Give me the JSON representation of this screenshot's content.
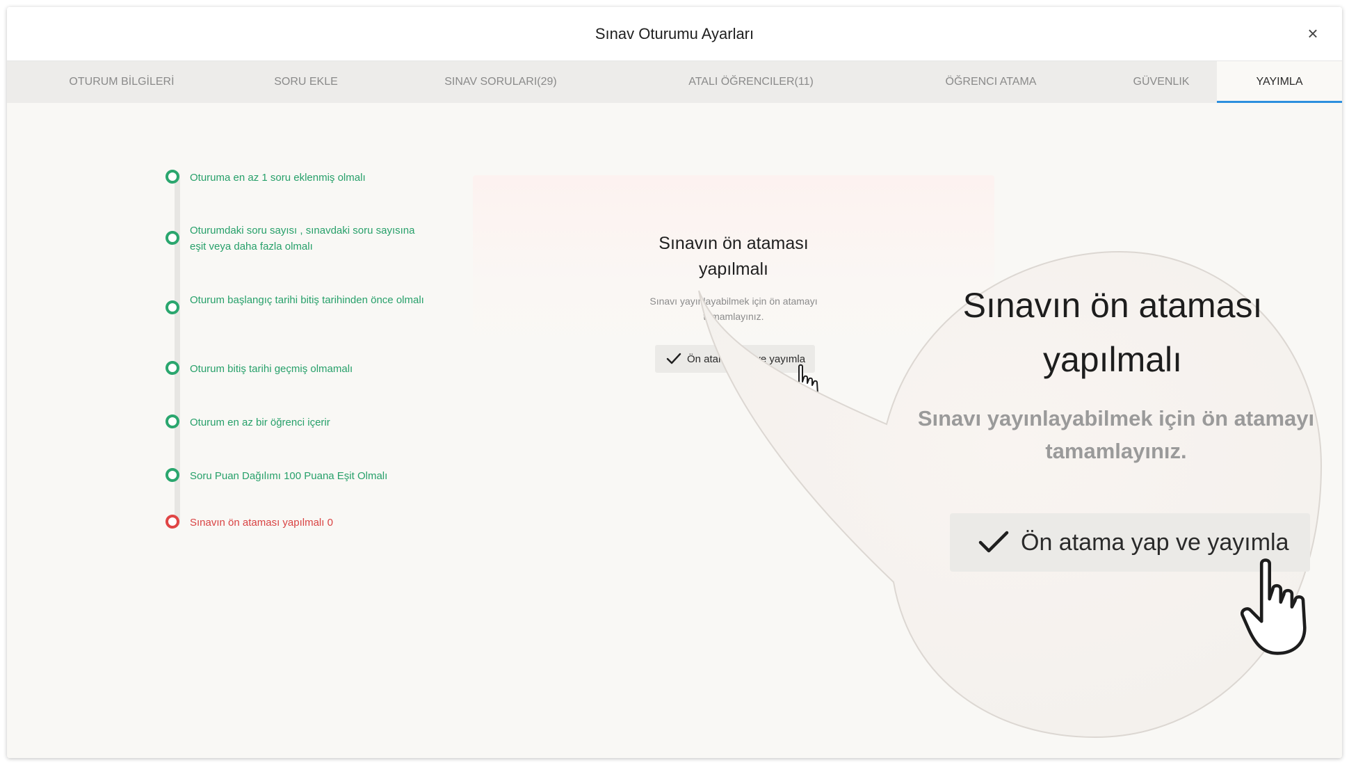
{
  "modal": {
    "title": "Sınav Oturumu Ayarları",
    "close_icon": "×"
  },
  "tabs": [
    {
      "label": "OTURUM BİLGİLERİ",
      "active": false
    },
    {
      "label": "SORU EKLE",
      "active": false
    },
    {
      "label": "SINAV SORULARI(29)",
      "active": false
    },
    {
      "label": "ATALI ÖĞRENCILER(11)",
      "active": false
    },
    {
      "label": "ÖĞRENCI ATAMA",
      "active": false
    },
    {
      "label": "GÜVENLIK",
      "active": false
    },
    {
      "label": "YAYIMLA",
      "active": true
    }
  ],
  "checklist": [
    {
      "label": "Oturuma en az 1 soru eklenmiş olmalı",
      "status": "passed"
    },
    {
      "label": "Oturumdaki soru sayısı , sınavdaki soru sayısına eşit veya daha fazla olmalı",
      "status": "passed"
    },
    {
      "label": "Oturum başlangıç tarihi bitiş tarihinden önce olmalı",
      "status": "passed"
    },
    {
      "label": "Oturum bitiş tarihi geçmiş olmamalı",
      "status": "passed"
    },
    {
      "label": "Oturum en az bir öğrenci içerir",
      "status": "passed"
    },
    {
      "label": "Soru Puan Dağılımı 100 Puana Eşit Olmalı",
      "status": "passed"
    },
    {
      "label": "Sınavın ön ataması yapılmalı 0",
      "status": "failed"
    }
  ],
  "panel": {
    "title": "Sınavın ön ataması yapılmalı",
    "description": "Sınavı yayınlayabilmek için ön atamayı tamamlayınız.",
    "button_label": "Ön atama yap ve yayımla"
  },
  "zoom": {
    "title": "Sınavın ön ataması yapılmalı",
    "description": "Sınavı yayınlayabilmek için ön atamayı tamamlayınız.",
    "button_label": "Ön atama yap ve yayımla"
  },
  "colors": {
    "passed": "#2aa66e",
    "failed": "#e04545",
    "active_tab_underline": "#2d8fde"
  },
  "icons": {
    "close": "close-icon",
    "check": "check-icon",
    "pointer": "hand-pointer-icon"
  }
}
